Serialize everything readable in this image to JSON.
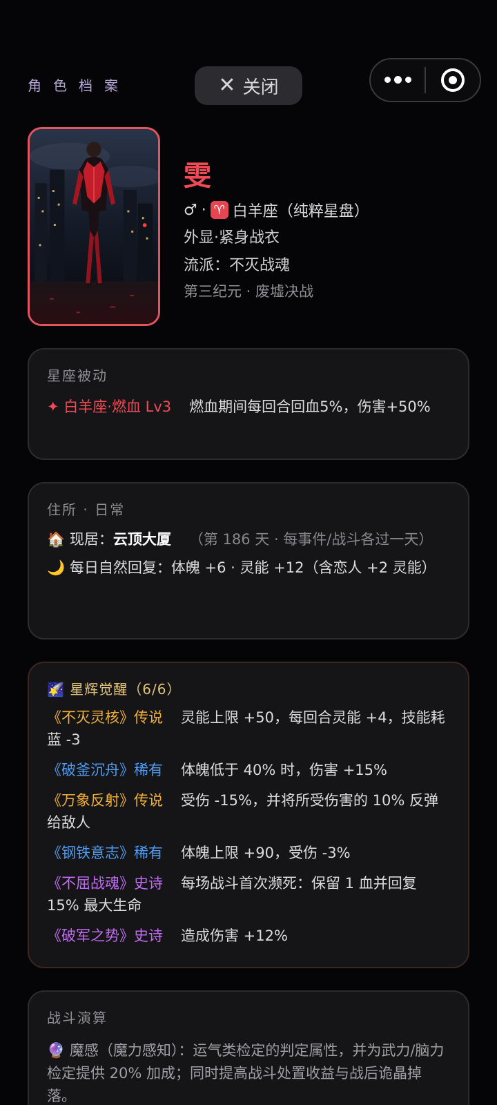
{
  "header": {
    "title": "角色档案",
    "close_label": "关闭"
  },
  "profile": {
    "name": "雯",
    "gender_symbol": "♂",
    "separator": "·",
    "zodiac_symbol": "♈",
    "zodiac_text": "白羊座（纯粹星盘）",
    "outfit": "外显·紧身战衣",
    "school": "流派：不灭战魂",
    "era": "第三纪元 · 废墟决战"
  },
  "passive": {
    "title": "星座被动",
    "label": "✦ 白羊座·燃血 Lv3",
    "desc": "燃血期间每回合回血5%，伤害+50%"
  },
  "home": {
    "title": "住所 · 日常",
    "icon": "🏠",
    "prefix": "现居：",
    "place": "云顶大厦",
    "note": "（第 186 天 · 每事件/战斗各过一天）",
    "recover_icon": "🌙",
    "recover_text": "每日自然回复：体魄 +6 · 灵能 +12（含恋人 +2 灵能）"
  },
  "awaken": {
    "icon": "🌠",
    "title": "星辉觉醒（6/6）",
    "items": [
      {
        "name": "《不灭灵核》传说",
        "desc": "灵能上限 +50，每回合灵能 +4，技能耗蓝 -3",
        "tier_color": "#f2b134"
      },
      {
        "name": "《破釜沉舟》稀有",
        "desc": "体魄低于 40% 时，伤害 +15%",
        "tier_color": "#4f9bf0"
      },
      {
        "name": "《万象反射》传说",
        "desc": "受伤 -15%，并将所受伤害的 10% 反弹给敌人",
        "tier_color": "#f2b134"
      },
      {
        "name": "《钢铁意志》稀有",
        "desc": "体魄上限 +90，受伤 -3%",
        "tier_color": "#4f9bf0"
      },
      {
        "name": "《不屈战魂》史诗",
        "desc": "每场战斗首次濒死：保留 1 血并回复 15% 最大生命",
        "tier_color": "#c06cf2"
      },
      {
        "name": "《破军之势》史诗",
        "desc": "造成伤害 +12%",
        "tier_color": "#c06cf2"
      }
    ]
  },
  "battle": {
    "title": "战斗演算",
    "icon": "🔮",
    "text": "魔感（魔力感知）：运气类检定的判定属性，并为武力/脑力检定提供 20% 加成；同时提高战斗处置收益与战后诡晶掉落。"
  }
}
